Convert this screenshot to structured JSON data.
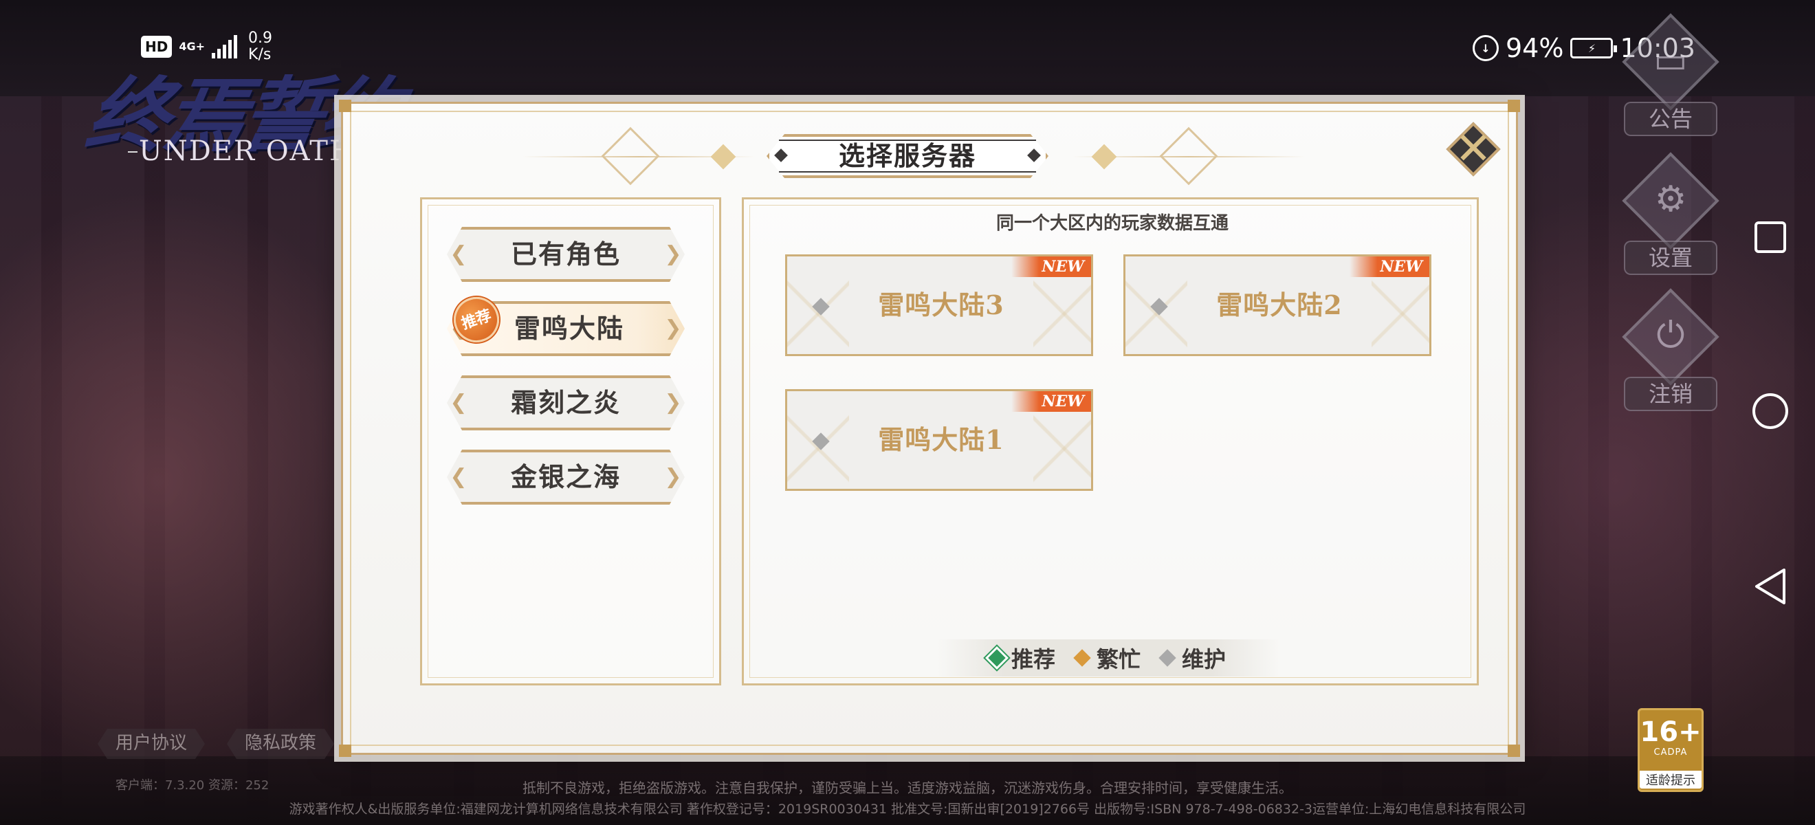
{
  "status_bar": {
    "hd": "HD",
    "network": "4G+",
    "speed_value": "0.9",
    "speed_unit": "K/s",
    "battery_percent": "94%",
    "time": "10:03"
  },
  "logo": {
    "title": "终焉誓约",
    "subtitle": "UNDER OATH"
  },
  "side_menu": {
    "notice": "公告",
    "settings": "设置",
    "logout": "注销"
  },
  "dialog": {
    "title": "选择服务器",
    "close_icon": "close-x-icon",
    "regions": [
      {
        "label": "已有角色",
        "active": false
      },
      {
        "label": "雷鸣大陆",
        "active": true,
        "badge": "推荐"
      },
      {
        "label": "霜刻之炎",
        "active": false
      },
      {
        "label": "金银之海",
        "active": false
      }
    ],
    "hint": "同一个大区内的玩家数据互通",
    "servers": [
      {
        "name": "雷鸣大陆3",
        "tag": "NEW",
        "status": "maintenance"
      },
      {
        "name": "雷鸣大陆2",
        "tag": "NEW",
        "status": "maintenance"
      },
      {
        "name": "雷鸣大陆1",
        "tag": "NEW",
        "status": "maintenance"
      }
    ],
    "legend": [
      {
        "label": "推荐",
        "color": "#2f9a5c"
      },
      {
        "label": "繁忙",
        "color": "#d99a3c"
      },
      {
        "label": "维护",
        "color": "#a9a9a9"
      }
    ]
  },
  "bottom_links": {
    "user_agreement": "用户协议",
    "privacy_policy": "隐私政策"
  },
  "version": "客户端：7.3.20  资源：252",
  "footer": {
    "line1": "抵制不良游戏，拒绝盗版游戏。注意自我保护，谨防受骗上当。适度游戏益脑，沉迷游戏伤身。合理安排时间，享受健康生活。",
    "line2": "游戏著作权人&出版服务单位:福建网龙计算机网络信息技术有限公司  著作权登记号：2019SR0030431  批准文号:国新出审[2019]2766号  出版物号:ISBN 978-7-498-06832-3运营单位:上海幻电信息科技有限公司"
  },
  "age_rating": {
    "age": "16+",
    "org": "CADPA",
    "label": "适龄提示"
  },
  "colors": {
    "gold": "#c9a877",
    "new_tag": "#e8642a",
    "badge": "#d55d19"
  }
}
